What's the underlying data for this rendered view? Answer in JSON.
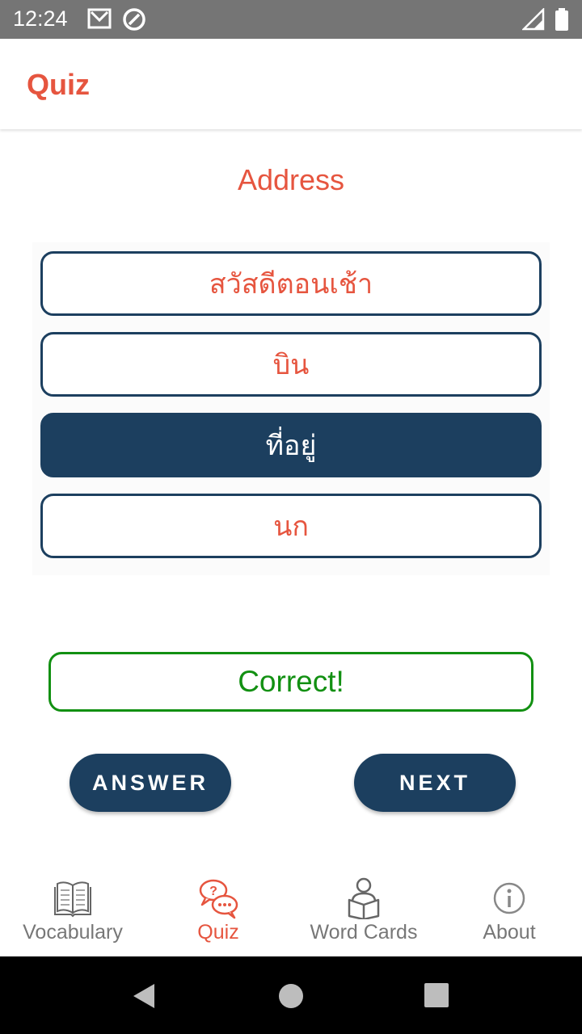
{
  "status_bar": {
    "time": "12:24",
    "left_icons": [
      "gmail-icon",
      "sync-icon"
    ],
    "right_icons": [
      "signal-icon",
      "battery-icon"
    ]
  },
  "app_bar": {
    "title": "Quiz"
  },
  "quiz": {
    "question": "Address",
    "options": [
      {
        "label": "สวัสดีตอนเช้า",
        "selected": false
      },
      {
        "label": "บิน",
        "selected": false
      },
      {
        "label": "ที่อยู่",
        "selected": true
      },
      {
        "label": "นก",
        "selected": false
      }
    ],
    "feedback": "Correct!",
    "answer_button": "ANSWER",
    "next_button": "NEXT"
  },
  "bottom_nav": {
    "items": [
      {
        "label": "Vocabulary",
        "icon": "book-icon",
        "active": false
      },
      {
        "label": "Quiz",
        "icon": "chat-question-icon",
        "active": true
      },
      {
        "label": "Word Cards",
        "icon": "reader-icon",
        "active": false
      },
      {
        "label": "About",
        "icon": "info-icon",
        "active": false
      }
    ]
  },
  "system_nav": {
    "icons": [
      "back-icon",
      "home-icon",
      "recents-icon"
    ]
  },
  "colors": {
    "accent": "#e6553f",
    "primary": "#1c3f5f",
    "success": "#129012",
    "status_bar": "#757575"
  }
}
